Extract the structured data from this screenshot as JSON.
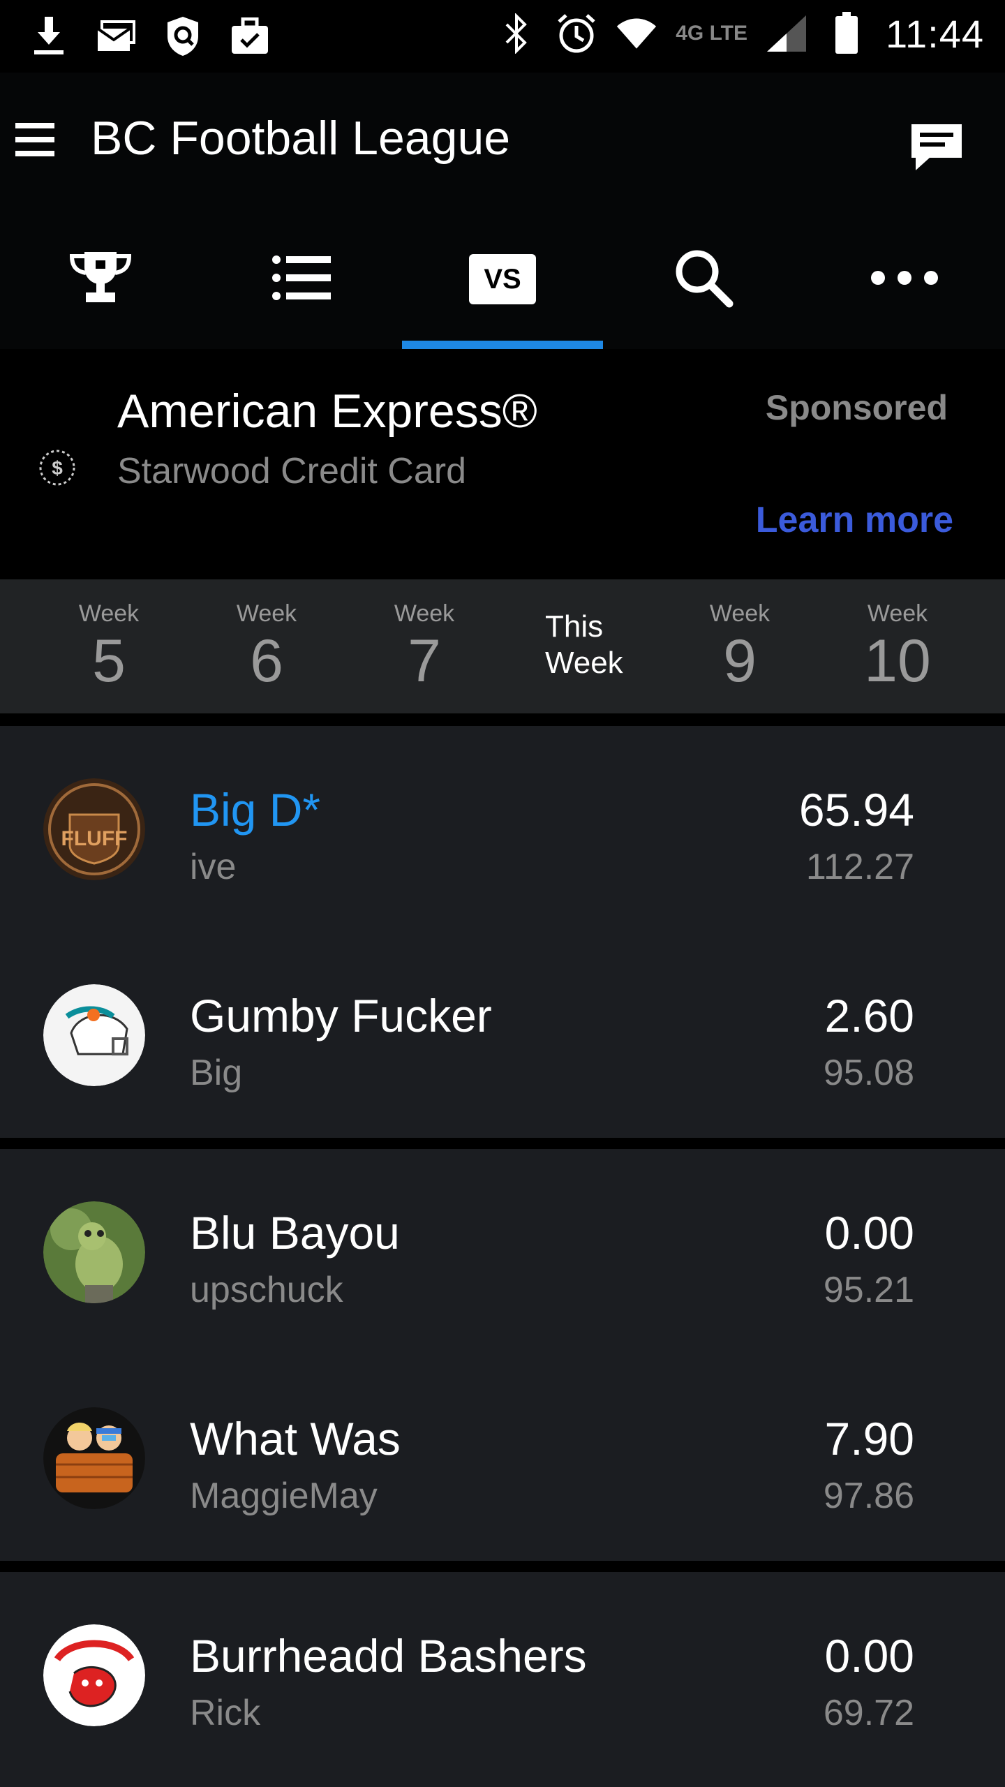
{
  "status_bar": {
    "left_icons": [
      "download-icon",
      "mail-icon",
      "shield-icon",
      "briefcase-icon"
    ],
    "right_icons": [
      "bluetooth-icon",
      "alarm-icon",
      "wifi-icon",
      "lte-icon",
      "signal-icon",
      "battery-icon"
    ],
    "network": "4G LTE",
    "time": "11:44"
  },
  "app_bar": {
    "title": "BC Football League"
  },
  "tabs": [
    {
      "icon": "trophy-icon"
    },
    {
      "icon": "list-icon"
    },
    {
      "icon": "vs-icon",
      "label": "VS",
      "selected": true
    },
    {
      "icon": "search-icon"
    },
    {
      "icon": "more-icon"
    }
  ],
  "ad": {
    "title": "American Express®",
    "subtitle": "Starwood Credit Card",
    "sponsored": "Sponsored",
    "cta": "Learn more"
  },
  "weeks": [
    {
      "label": "Week",
      "number": "5"
    },
    {
      "label": "Week",
      "number": "6"
    },
    {
      "label": "Week",
      "number": "7"
    },
    {
      "label": "This\nWeek",
      "current": true
    },
    {
      "label": "Week",
      "number": "9"
    },
    {
      "label": "Week",
      "number": "10"
    }
  ],
  "matchups": [
    {
      "teams": [
        {
          "name": "Big D*",
          "owner": "ive",
          "score": "65.94",
          "projected": "112.27",
          "avatar": "fluff-logo",
          "active": true
        },
        {
          "name": "Gumby Fucker",
          "owner": "Big",
          "score": "2.60",
          "projected": "95.08",
          "avatar": "dolphins-helmet-logo"
        }
      ]
    },
    {
      "teams": [
        {
          "name": "Blu Bayou",
          "owner": "upschuck",
          "score": "0.00",
          "projected": "95.21",
          "avatar": "frog-photo"
        },
        {
          "name": "What Was",
          "owner": "MaggieMay",
          "score": "7.90",
          "projected": "97.86",
          "avatar": "hot-tub-logo"
        }
      ]
    },
    {
      "teams": [
        {
          "name": "Burrheadd Bashers",
          "owner": "Rick",
          "score": "0.00",
          "projected": "69.72",
          "avatar": "bashers-logo"
        }
      ]
    }
  ],
  "colors": {
    "accent": "#1e88e5",
    "active_team": "#2196f3",
    "learn_more": "#3b5bdb",
    "card_bg": "#1b1d21",
    "week_bar_bg": "#212325"
  }
}
